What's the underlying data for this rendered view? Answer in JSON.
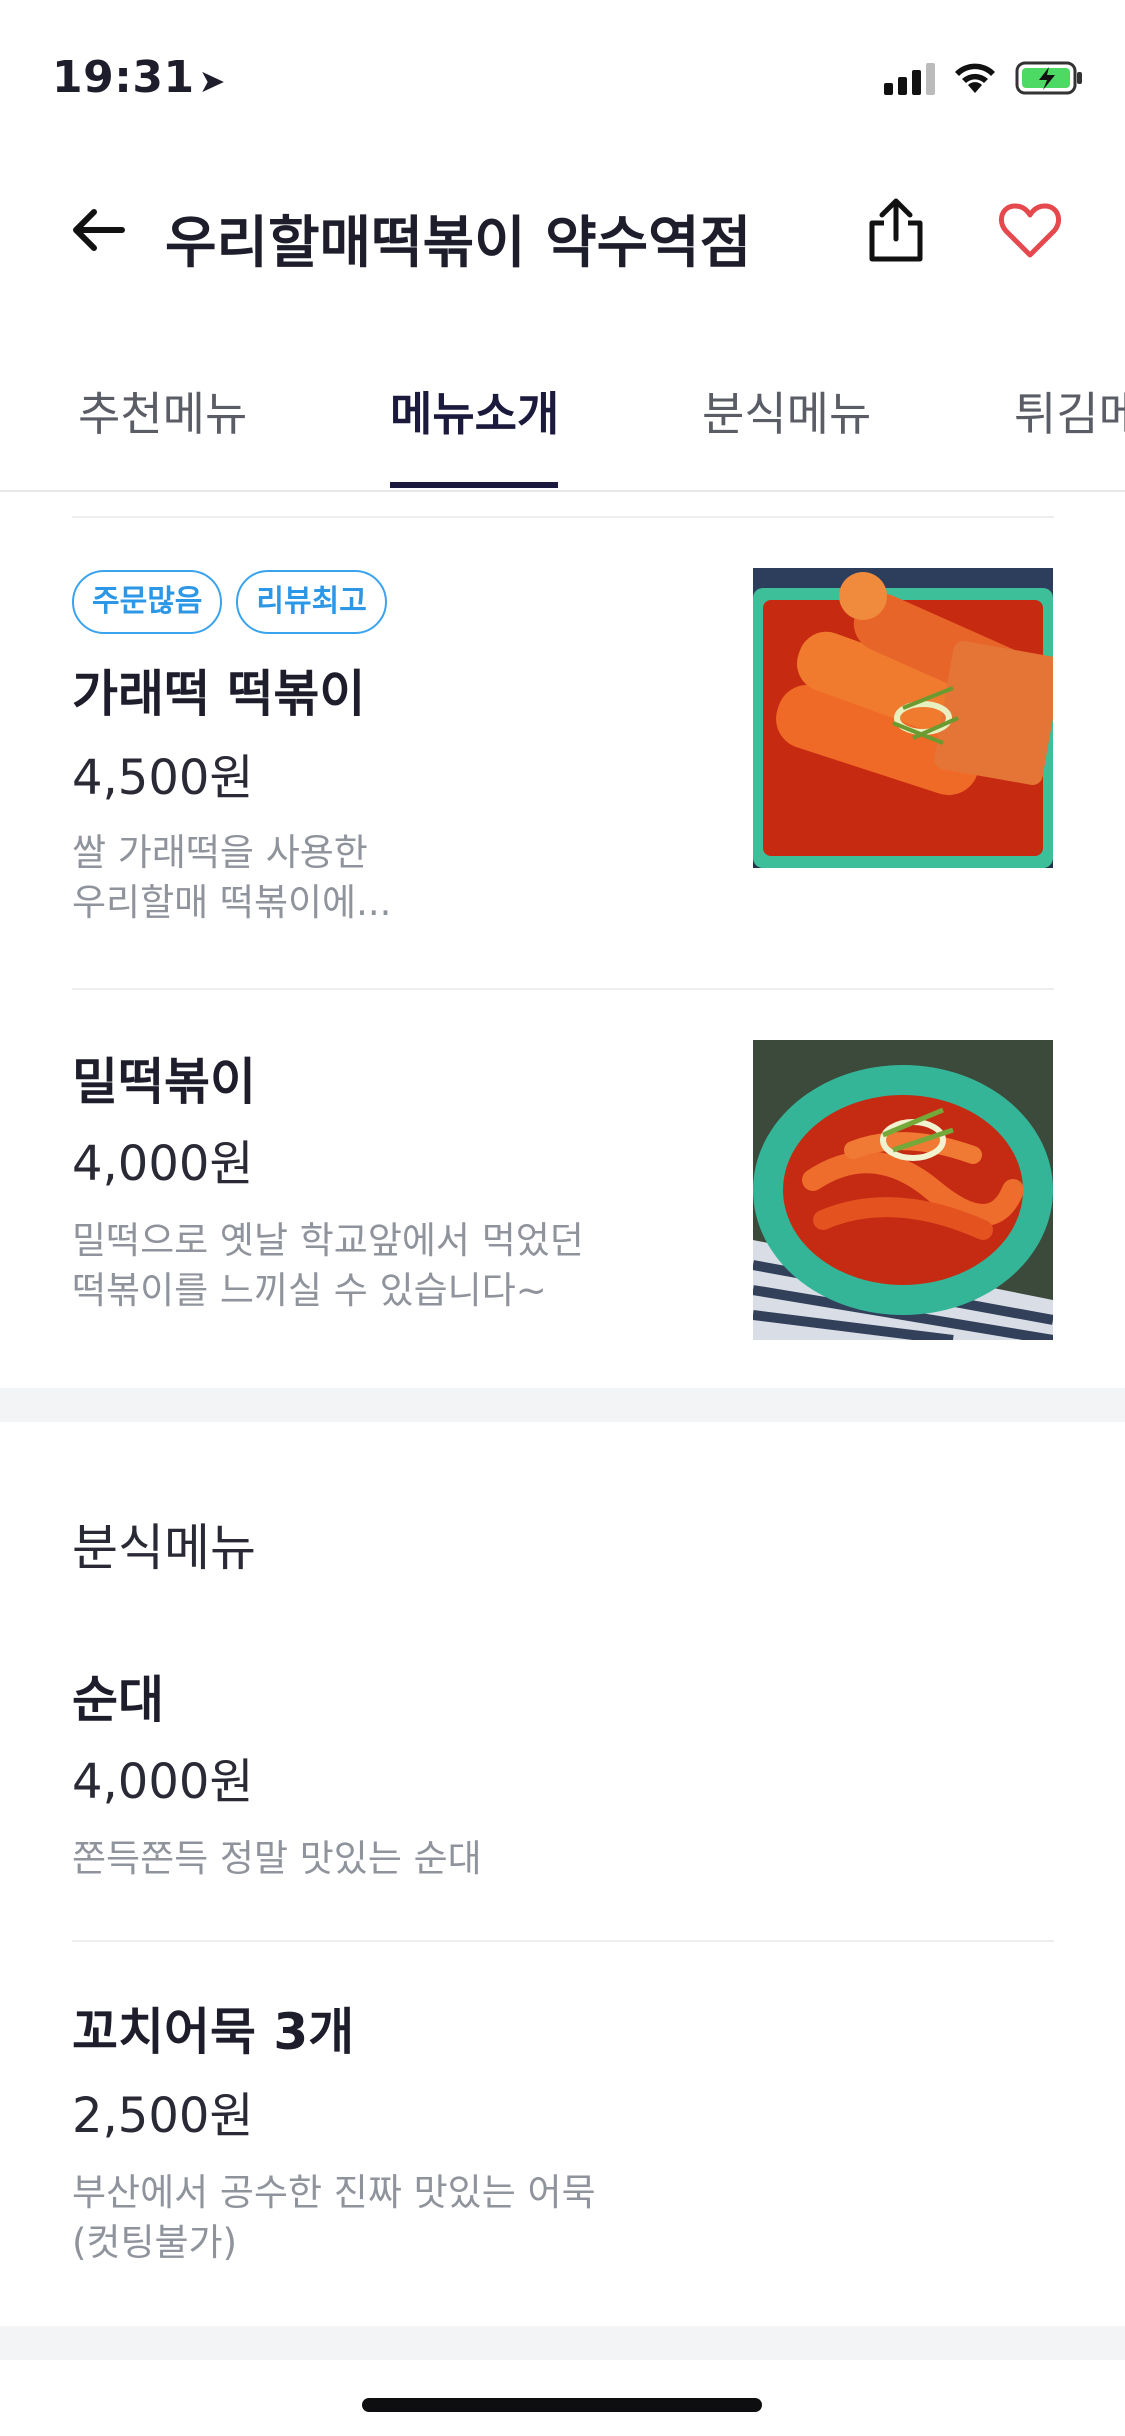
{
  "status_bar": {
    "time": "19:31"
  },
  "header": {
    "title": "우리할매떡볶이 약수역점"
  },
  "tabs": [
    {
      "label": "추천메뉴"
    },
    {
      "label": "메뉴소개",
      "active": true
    },
    {
      "label": "분식메뉴"
    },
    {
      "label": "튀김메"
    }
  ],
  "items": [
    {
      "badges": [
        "주문많음",
        "리뷰최고"
      ],
      "name": "가래떡 떡볶이",
      "price": "4,500원",
      "desc_line1": "쌀 가래떡을 사용한",
      "desc_line2": "우리할매 떡볶이에..."
    },
    {
      "name": "밀떡볶이",
      "price": "4,000원",
      "desc_line1": "밀떡으로 옛날 학교앞에서 먹었던",
      "desc_line2": "떡볶이를 느끼실 수 있습니다~"
    }
  ],
  "section2": {
    "title": "분식메뉴",
    "items": [
      {
        "name": "순대",
        "price": "4,000원",
        "desc_line1": "쫀득쫀득 정말 맛있는 순대"
      },
      {
        "name": "꼬치어묵 3개",
        "price": "2,500원",
        "desc_line1": "부산에서 공수한 진짜 맛있는 어묵",
        "desc_line2": "(컷팅불가)"
      }
    ]
  },
  "colors": {
    "accent_blue": "#2c97e6",
    "heart_red": "#e5484d",
    "tab_active": "#1b1a3d"
  },
  "icons": {
    "back": "arrow-left-icon",
    "share": "share-icon",
    "favorite": "heart-outline-icon",
    "location": "location-arrow-icon",
    "signal": "cellular-signal-icon",
    "wifi": "wifi-icon",
    "battery": "battery-charging-icon"
  }
}
